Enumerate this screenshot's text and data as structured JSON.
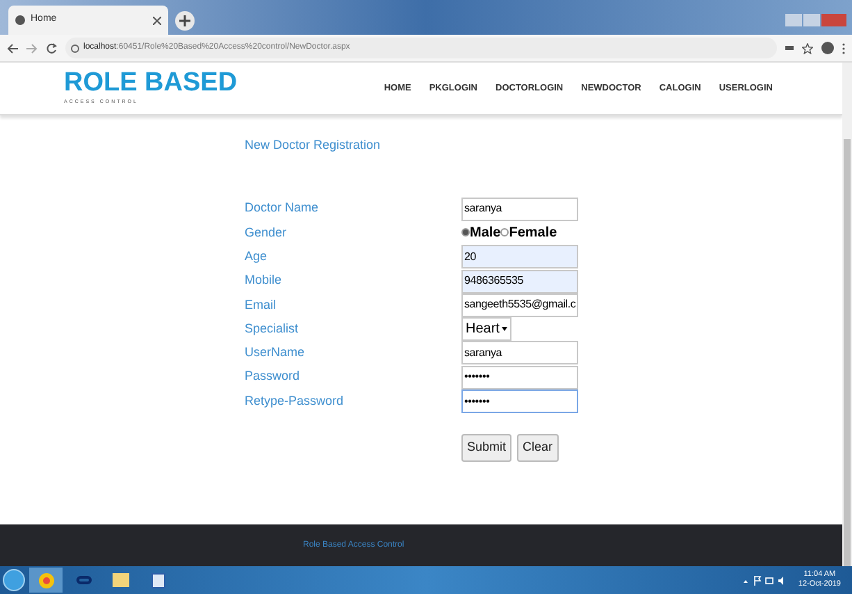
{
  "browser": {
    "tab_title": "Home",
    "url_host": "localhost",
    "url_path": ":60451/Role%20Based%20Access%20control/NewDoctor.aspx"
  },
  "header": {
    "logo": "ROLE BASED",
    "logo_sub": "ACCESS CONTROL",
    "nav": [
      "HOME",
      "PKGLOGIN",
      "DOCTORLOGIN",
      "NEWDOCTOR",
      "CALOGIN",
      "USERLOGIN"
    ]
  },
  "form": {
    "title": "New Doctor Registration",
    "fields": [
      {
        "label": "Doctor Name",
        "kind": "text",
        "value": "saranya",
        "autofilled": false,
        "focused": false
      },
      {
        "label": "Gender",
        "kind": "radio",
        "options": [
          {
            "label": "Male",
            "selected": true
          },
          {
            "label": "Female",
            "selected": false
          }
        ]
      },
      {
        "label": "Age",
        "kind": "text",
        "value": "20",
        "autofilled": true,
        "focused": false
      },
      {
        "label": "Mobile",
        "kind": "text",
        "value": "9486365535",
        "autofilled": true,
        "focused": false
      },
      {
        "label": "Email",
        "kind": "text",
        "value": "sangeeth5535@gmail.c",
        "autofilled": false,
        "focused": false
      },
      {
        "label": "Specialist",
        "kind": "select",
        "value": "Heart"
      },
      {
        "label": "UserName",
        "kind": "text",
        "value": "saranya",
        "autofilled": false,
        "focused": false
      },
      {
        "label": "Password",
        "kind": "text",
        "value": "•••••••",
        "autofilled": false,
        "focused": false
      },
      {
        "label": "Retype-Password",
        "kind": "text",
        "value": "•••••••",
        "autofilled": false,
        "focused": true
      }
    ],
    "buttons": [
      "Submit",
      "Clear"
    ]
  },
  "footer": "Role Based Access Control",
  "taskbar": {
    "time": "11:04 AM",
    "date": "12-Oct-2019"
  }
}
